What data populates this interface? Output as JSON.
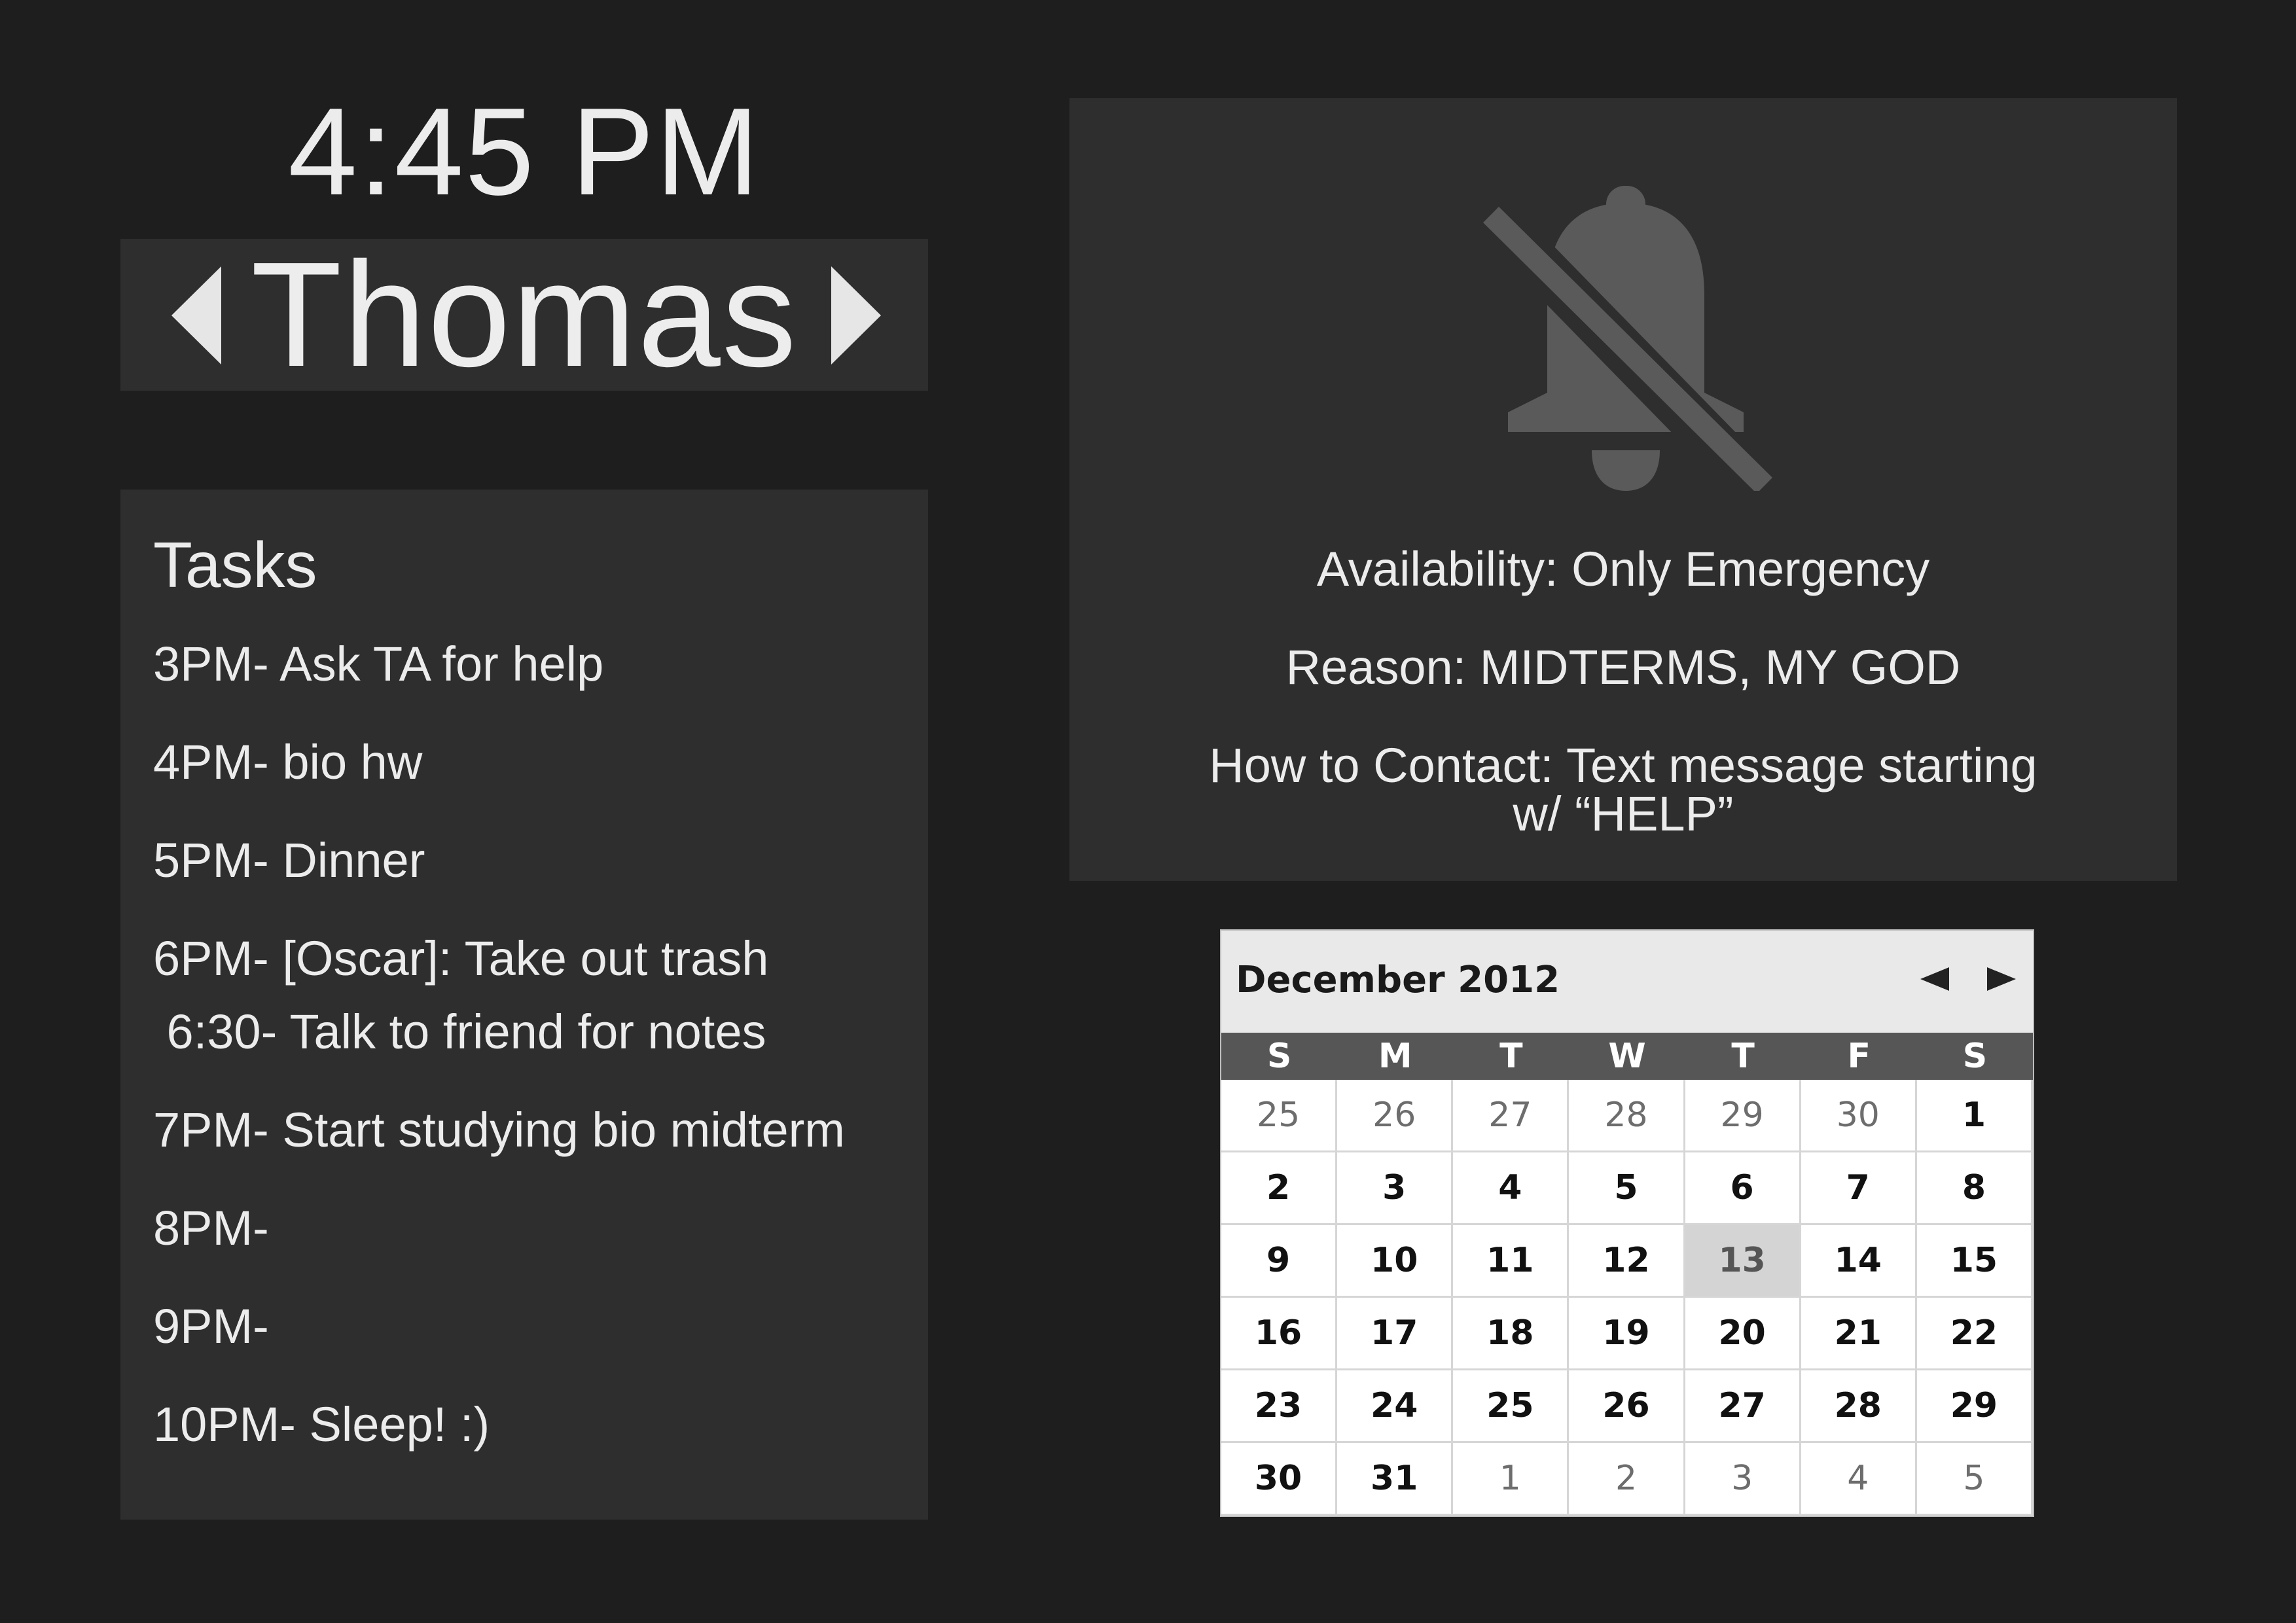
{
  "clock": {
    "time": "4:45 PM"
  },
  "user_switcher": {
    "name": "Thomas",
    "prev_icon": "caret-left-icon",
    "next_icon": "caret-right-icon"
  },
  "tasks": {
    "title": "Tasks",
    "items": [
      "3PM- Ask TA for help",
      "4PM- bio hw",
      "5PM- Dinner",
      "6PM- [Oscar]: Take out trash",
      " 6:30- Talk to friend for notes",
      "7PM- Start studying bio midterm",
      "8PM-",
      "9PM-",
      "10PM- Sleep! :)"
    ]
  },
  "availability": {
    "icon": "bell-off-icon",
    "availability_text": "Availability: Only Emergency",
    "reason_text": "Reason: MIDTERMS, MY GOD",
    "contact_line1": "How to Contact: Text message starting",
    "contact_line2": "w/ “HELP”"
  },
  "calendar": {
    "title": "December 2012",
    "prev_icon": "triangle-left-icon",
    "next_icon": "triangle-right-icon",
    "weekdays": [
      "S",
      "M",
      "T",
      "W",
      "T",
      "F",
      "S"
    ],
    "today": "13",
    "weeks": [
      [
        "25",
        "26",
        "27",
        "28",
        "29",
        "30",
        "1"
      ],
      [
        "2",
        "3",
        "4",
        "5",
        "6",
        "7",
        "8"
      ],
      [
        "9",
        "10",
        "11",
        "12",
        "13",
        "14",
        "15"
      ],
      [
        "16",
        "17",
        "18",
        "19",
        "20",
        "21",
        "22"
      ],
      [
        "23",
        "24",
        "25",
        "26",
        "27",
        "28",
        "29"
      ],
      [
        "30",
        "31",
        "1",
        "2",
        "3",
        "4",
        "5"
      ]
    ]
  },
  "colors": {
    "background": "#1e1e1e",
    "panel": "#2e2e2e",
    "text": "#ececec",
    "bell_icon": "#5a5a5a",
    "calendar_weekday_bar": "#565656",
    "calendar_today": "#d4d4d4"
  }
}
